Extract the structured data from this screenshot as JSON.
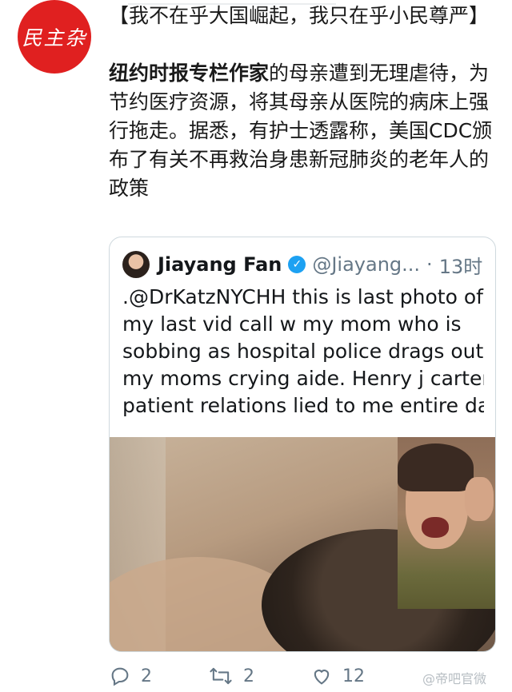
{
  "author_avatar": {
    "text": "民主杂"
  },
  "post": {
    "line1": "【我不在乎大国崛起，我只在乎小民尊严】",
    "bold_lead": "纽约时报专栏作家",
    "body": "的母亲遭到无理虐待，为节约医疗资源，将其母亲从医院的病床上强行拖走。据悉，有护士透露称，美国CDC颁布了有关不再救治身患新冠肺炎的老年人的政策"
  },
  "quote": {
    "name": "Jiayang Fan",
    "handle": "@Jiayang...",
    "separator": "·",
    "time": "13时",
    "lines": [
      ".@DrKatzNYCHH this is last photo of",
      "my last vid call w my mom who is",
      "sobbing as hospital police drags out",
      "my moms crying aide. Henry j carter",
      "patient relations lied to me entire da..."
    ]
  },
  "actions": {
    "reply_count": "2",
    "retweet_count": "2",
    "like_count": "12"
  },
  "watermark": "@帝吧官微",
  "colors": {
    "avatar_red": "#e02020",
    "verified_blue": "#1da1f2",
    "muted": "#657786"
  }
}
